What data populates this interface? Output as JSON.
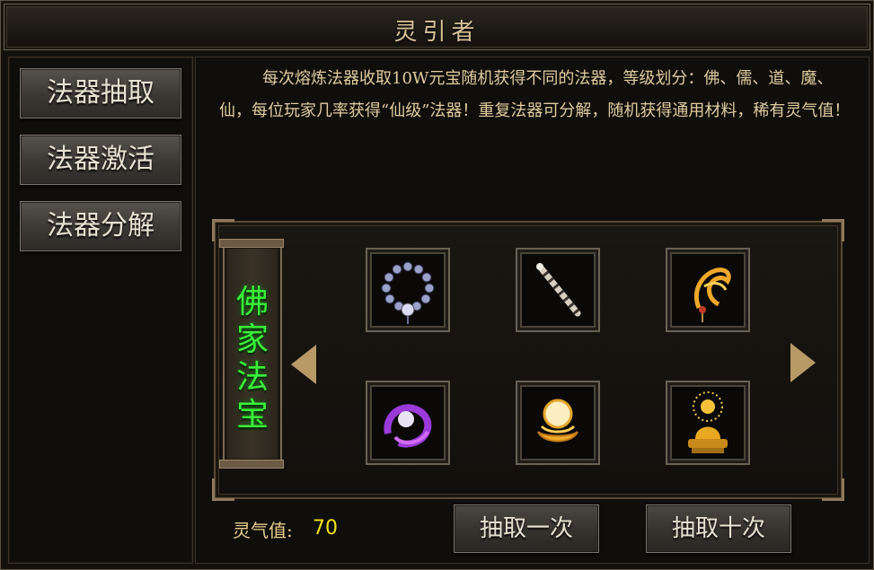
{
  "window": {
    "title": "灵引者"
  },
  "sidebar": {
    "items": [
      {
        "label": "法器抽取"
      },
      {
        "label": "法器激活"
      },
      {
        "label": "法器分解"
      }
    ]
  },
  "description": "每次熔炼法器收取10W元宝随机获得不同的法器，等级划分：佛、儒、道、魔、仙，每位玩家几率获得“仙级”法器！重复法器可分解，随机获得通用材料，稀有灵气值！",
  "gallery": {
    "category_label": "佛家法宝",
    "items": [
      {
        "icon": "prayer-beads-icon"
      },
      {
        "icon": "sutra-rod-icon"
      },
      {
        "icon": "golden-phoenix-icon"
      },
      {
        "icon": "purple-flame-orb-icon"
      },
      {
        "icon": "golden-ring-icon"
      },
      {
        "icon": "golden-buddha-icon"
      }
    ]
  },
  "footer": {
    "points_label": "灵气值:",
    "points_value": "70",
    "draw_once_label": "抽取一次",
    "draw_ten_label": "抽取十次"
  },
  "colors": {
    "category_text": "#3bef3a",
    "points_value": "#f2e21a",
    "description_text": "#e0cca0"
  }
}
